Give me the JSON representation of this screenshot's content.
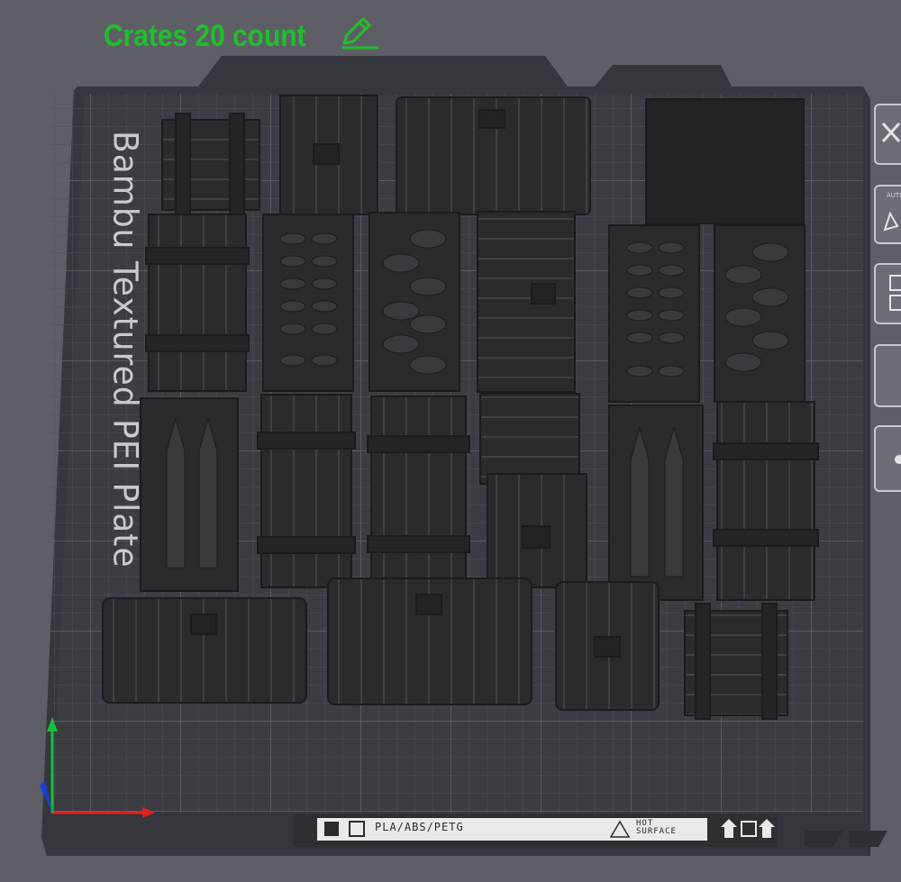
{
  "header": {
    "plate_name": "Crates 20 count",
    "edit_icon": "pencil-edit-icon",
    "accent_color": "#1fbf2b"
  },
  "plate": {
    "label": "Bambu Textured PEI Plate",
    "strip": {
      "material": "PLA/ABS/PETG",
      "warning_line1": "HOT",
      "warning_line2": "SURFACE"
    },
    "surface_color": "#3d3e44",
    "grid_color": "#55565c"
  },
  "side_toolbar": {
    "auto_label": "AUTO",
    "buttons": [
      "close-icon",
      "auto-orient-icon",
      "arrange-icon",
      "split-icon",
      "more-icon"
    ]
  },
  "axes": {
    "x_color": "#e02020",
    "y_color": "#12c23a",
    "z_color": "#1a3fd0"
  },
  "model_color": "#2b2b2e"
}
